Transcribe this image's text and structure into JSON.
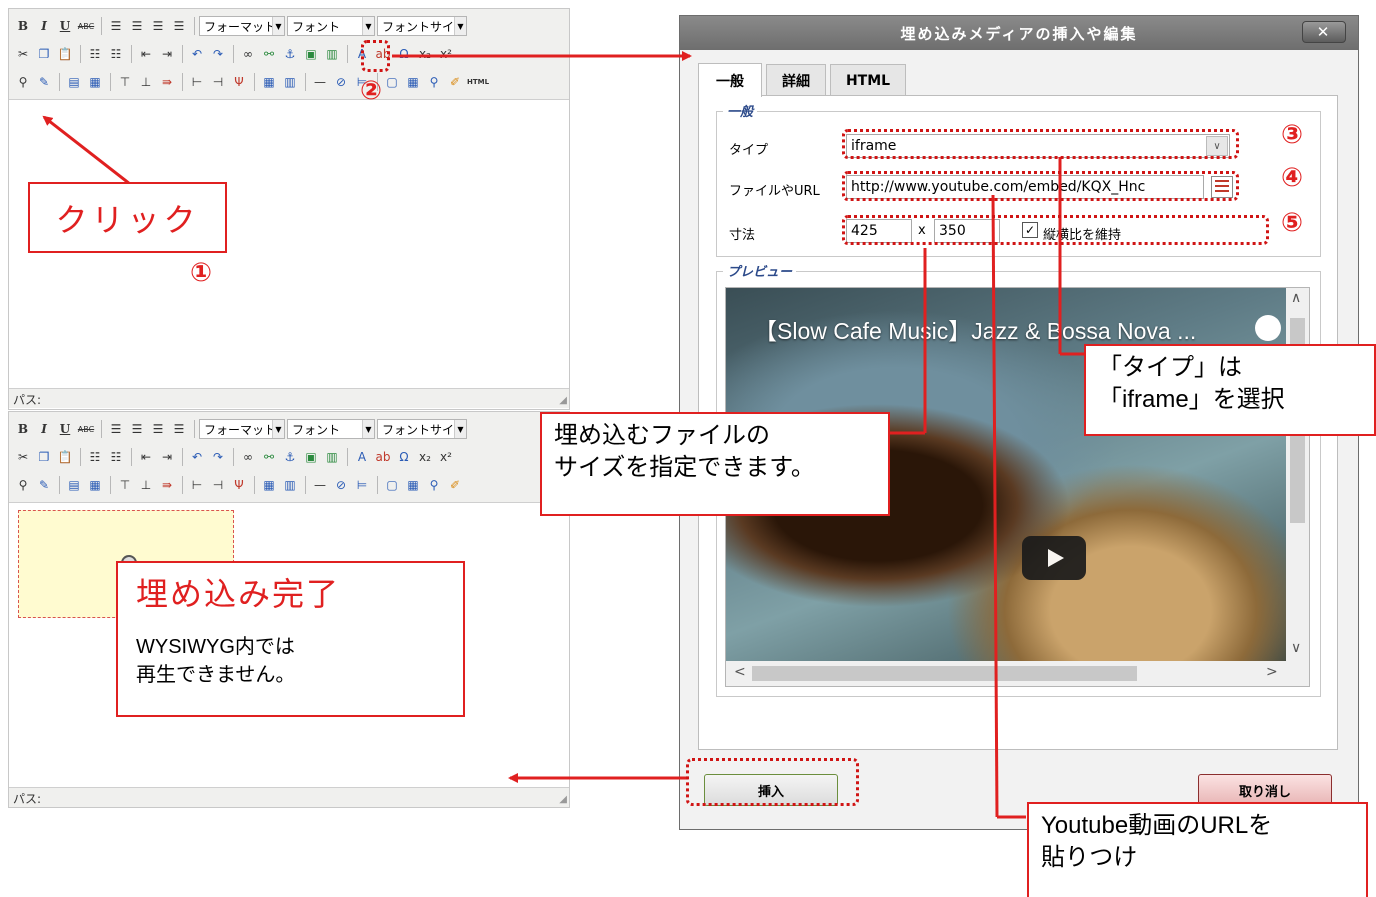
{
  "editor": {
    "toolbar": {
      "format_label": "フォーマット",
      "font_label": "フォント",
      "fontsize_label": "フォントサイズ",
      "html_label": "HTML"
    },
    "path_label": "パス:"
  },
  "dialog": {
    "title": "埋め込みメディアの挿入や編集",
    "close_label": "✕",
    "tabs": [
      "一般",
      "詳細",
      "HTML"
    ],
    "general_legend": "一般",
    "type_label": "タイプ",
    "type_value": "iframe",
    "url_label": "ファイルやURL",
    "url_value": "http://www.youtube.com/embed/KQX_Hnc",
    "size_label": "寸法",
    "width_value": "425",
    "size_separator": "x",
    "height_value": "350",
    "keep_ratio_label": "縦横比を維持",
    "keep_ratio_checked": true,
    "preview_legend": "プレビュー",
    "video_title": "【Slow Cafe Music】Jazz & Bossa Nova ...",
    "insert_label": "挿入",
    "cancel_label": "取り消し"
  },
  "annotations": {
    "click_label": "クリック",
    "num1": "①",
    "num2": "②",
    "num3": "③",
    "num4": "④",
    "num5": "⑤",
    "type_note_line1": "「タイプ」は",
    "type_note_line2": "「iframe」を選択",
    "size_note_line1": "埋め込むファイルの",
    "size_note_line2": "サイズを指定できます。",
    "done_title": "埋め込み完了",
    "done_line1": "WYSIWYG内では",
    "done_line2": "再生できません。",
    "url_note_line1": "Youtube動画のURLを",
    "url_note_line2": "貼りつけ"
  },
  "colors": {
    "annotation_red": "#e02020",
    "dialog_title_bg": "#7a7a7a",
    "placeholder_bg": "#fffbd0"
  }
}
